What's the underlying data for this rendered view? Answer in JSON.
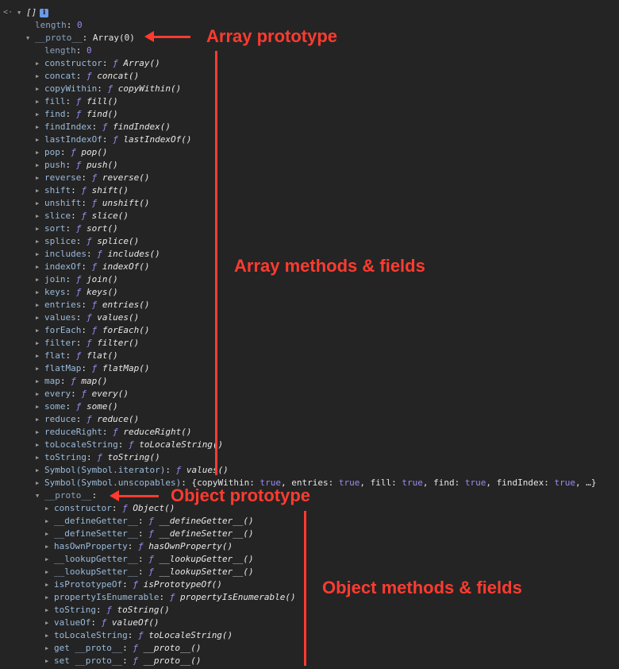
{
  "console": {
    "prompt_icon": "return-arrow-icon",
    "root": {
      "label": "[]",
      "info_badge": "i"
    },
    "root_length": {
      "key": "length",
      "value": "0"
    },
    "array_proto": {
      "key": "__proto__",
      "value": "Array(0)"
    },
    "array_length": {
      "key": "length",
      "value": "0"
    },
    "array_methods": [
      {
        "key": "constructor",
        "fn": "Array()"
      },
      {
        "key": "concat",
        "fn": "concat()"
      },
      {
        "key": "copyWithin",
        "fn": "copyWithin()"
      },
      {
        "key": "fill",
        "fn": "fill()"
      },
      {
        "key": "find",
        "fn": "find()"
      },
      {
        "key": "findIndex",
        "fn": "findIndex()"
      },
      {
        "key": "lastIndexOf",
        "fn": "lastIndexOf()"
      },
      {
        "key": "pop",
        "fn": "pop()"
      },
      {
        "key": "push",
        "fn": "push()"
      },
      {
        "key": "reverse",
        "fn": "reverse()"
      },
      {
        "key": "shift",
        "fn": "shift()"
      },
      {
        "key": "unshift",
        "fn": "unshift()"
      },
      {
        "key": "slice",
        "fn": "slice()"
      },
      {
        "key": "sort",
        "fn": "sort()"
      },
      {
        "key": "splice",
        "fn": "splice()"
      },
      {
        "key": "includes",
        "fn": "includes()"
      },
      {
        "key": "indexOf",
        "fn": "indexOf()"
      },
      {
        "key": "join",
        "fn": "join()"
      },
      {
        "key": "keys",
        "fn": "keys()"
      },
      {
        "key": "entries",
        "fn": "entries()"
      },
      {
        "key": "values",
        "fn": "values()"
      },
      {
        "key": "forEach",
        "fn": "forEach()"
      },
      {
        "key": "filter",
        "fn": "filter()"
      },
      {
        "key": "flat",
        "fn": "flat()"
      },
      {
        "key": "flatMap",
        "fn": "flatMap()"
      },
      {
        "key": "map",
        "fn": "map()"
      },
      {
        "key": "every",
        "fn": "every()"
      },
      {
        "key": "some",
        "fn": "some()"
      },
      {
        "key": "reduce",
        "fn": "reduce()"
      },
      {
        "key": "reduceRight",
        "fn": "reduceRight()"
      },
      {
        "key": "toLocaleString",
        "fn": "toLocaleString()"
      },
      {
        "key": "toString",
        "fn": "toString()"
      },
      {
        "key": "Symbol(Symbol.iterator)",
        "fn": "values()"
      }
    ],
    "unscopables": {
      "key": "Symbol(Symbol.unscopables)",
      "preview": [
        {
          "k": "copyWithin",
          "v": "true"
        },
        {
          "k": "entries",
          "v": "true"
        },
        {
          "k": "fill",
          "v": "true"
        },
        {
          "k": "find",
          "v": "true"
        },
        {
          "k": "findIndex",
          "v": "true"
        }
      ],
      "ellipsis": "…"
    },
    "object_proto": {
      "key": "__proto__"
    },
    "object_methods": [
      {
        "key": "constructor",
        "fn": "Object()"
      },
      {
        "key": "__defineGetter__",
        "fn": "__defineGetter__()"
      },
      {
        "key": "__defineSetter__",
        "fn": "__defineSetter__()"
      },
      {
        "key": "hasOwnProperty",
        "fn": "hasOwnProperty()"
      },
      {
        "key": "__lookupGetter__",
        "fn": "__lookupGetter__()"
      },
      {
        "key": "__lookupSetter__",
        "fn": "__lookupSetter__()"
      },
      {
        "key": "isPrototypeOf",
        "fn": "isPrototypeOf()"
      },
      {
        "key": "propertyIsEnumerable",
        "fn": "propertyIsEnumerable()"
      },
      {
        "key": "toString",
        "fn": "toString()"
      },
      {
        "key": "valueOf",
        "fn": "valueOf()"
      },
      {
        "key": "toLocaleString",
        "fn": "toLocaleString()"
      },
      {
        "key": "get __proto__",
        "fn": "__proto__()"
      },
      {
        "key": "set __proto__",
        "fn": "__proto__()"
      }
    ],
    "function_marker": "ƒ"
  },
  "annotations": {
    "array_prototype": "Array prototype",
    "array_methods": "Array methods & fields",
    "object_prototype": "Object prototype",
    "object_methods": "Object methods & fields",
    "color": "#ff3b30"
  }
}
